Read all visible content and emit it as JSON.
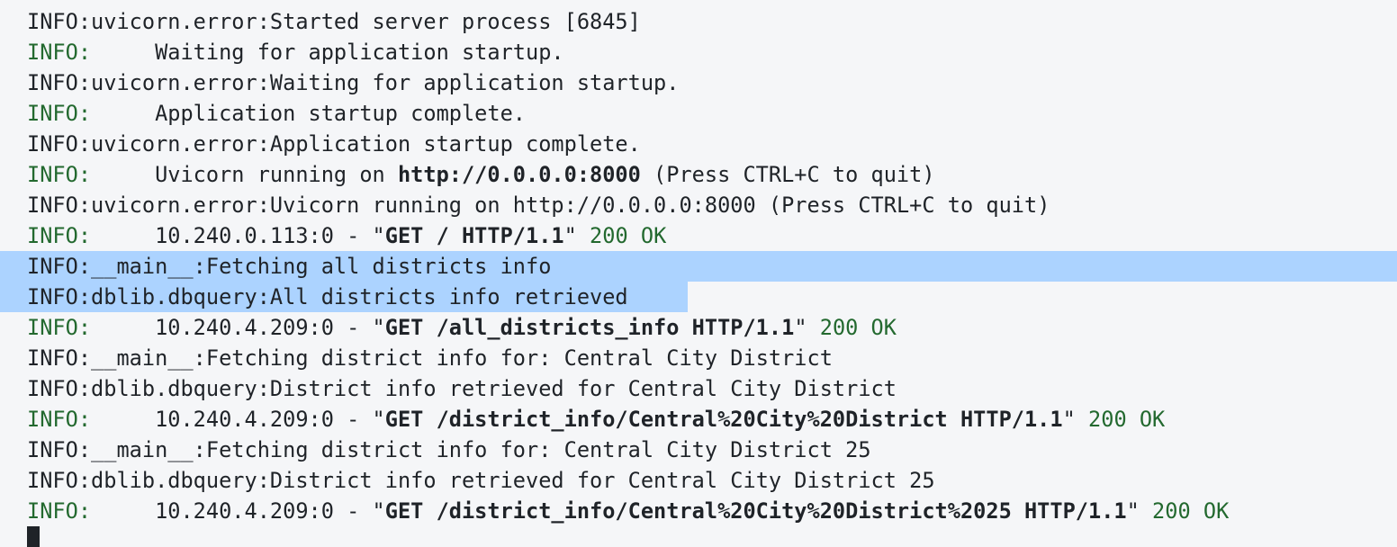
{
  "log": {
    "lines": [
      {
        "level": "INFO",
        "sep": ":",
        "text": "uvicorn.error:Started server process [6845]"
      },
      {
        "level": "INFO",
        "sep": ":     ",
        "text": "Waiting for application startup."
      },
      {
        "level": "INFO",
        "sep": ":",
        "text": "uvicorn.error:Waiting for application startup."
      },
      {
        "level": "INFO",
        "sep": ":     ",
        "text": "Application startup complete."
      },
      {
        "level": "INFO",
        "sep": ":",
        "text": "uvicorn.error:Application startup complete."
      },
      {
        "level": "INFO",
        "sep": ":     ",
        "pre": "Uvicorn running on ",
        "url": "http://0.0.0.0:8000",
        "post": " (Press CTRL+C to quit)"
      },
      {
        "level": "INFO",
        "sep": ":",
        "text": "uvicorn.error:Uvicorn running on http://0.0.0.0:8000 (Press CTRL+C to quit)"
      },
      {
        "level": "INFO",
        "sep": ":     ",
        "client": "10.240.0.113:0 - \"",
        "request": "GET / HTTP/1.1",
        "close": "\" ",
        "status": "200 OK"
      },
      {
        "level": "INFO",
        "sep": ":",
        "text": "__main__:Fetching all districts info"
      },
      {
        "level": "INFO",
        "sep": ":",
        "text": "dblib.dbquery:All districts info retrieved"
      },
      {
        "level": "INFO",
        "sep": ":     ",
        "client": "10.240.4.209:0 - \"",
        "request": "GET /all_districts_info HTTP/1.1",
        "close": "\" ",
        "status": "200 OK"
      },
      {
        "level": "INFO",
        "sep": ":",
        "text": "__main__:Fetching district info for: Central City District"
      },
      {
        "level": "INFO",
        "sep": ":",
        "text": "dblib.dbquery:District info retrieved for Central City District"
      },
      {
        "level": "INFO",
        "sep": ":     ",
        "client": "10.240.4.209:0 - \"",
        "request": "GET /district_info/Central%20City%20District HTTP/1.1",
        "close": "\" ",
        "status": "200 OK"
      },
      {
        "level": "INFO",
        "sep": ":",
        "text": "__main__:Fetching district info for: Central City District 25"
      },
      {
        "level": "INFO",
        "sep": ":",
        "text": "dblib.dbquery:District info retrieved for Central City District 25"
      },
      {
        "level": "INFO",
        "sep": ":     ",
        "client": "10.240.4.209:0 - \"",
        "request": "GET /district_info/Central%20City%20District%2025 HTTP/1.1",
        "close": "\" ",
        "status": "200 OK"
      }
    ]
  },
  "colors": {
    "background": "#f5f6f8",
    "text": "#1f2328",
    "level_green": "#23692f",
    "selection": "#acd3ff"
  }
}
